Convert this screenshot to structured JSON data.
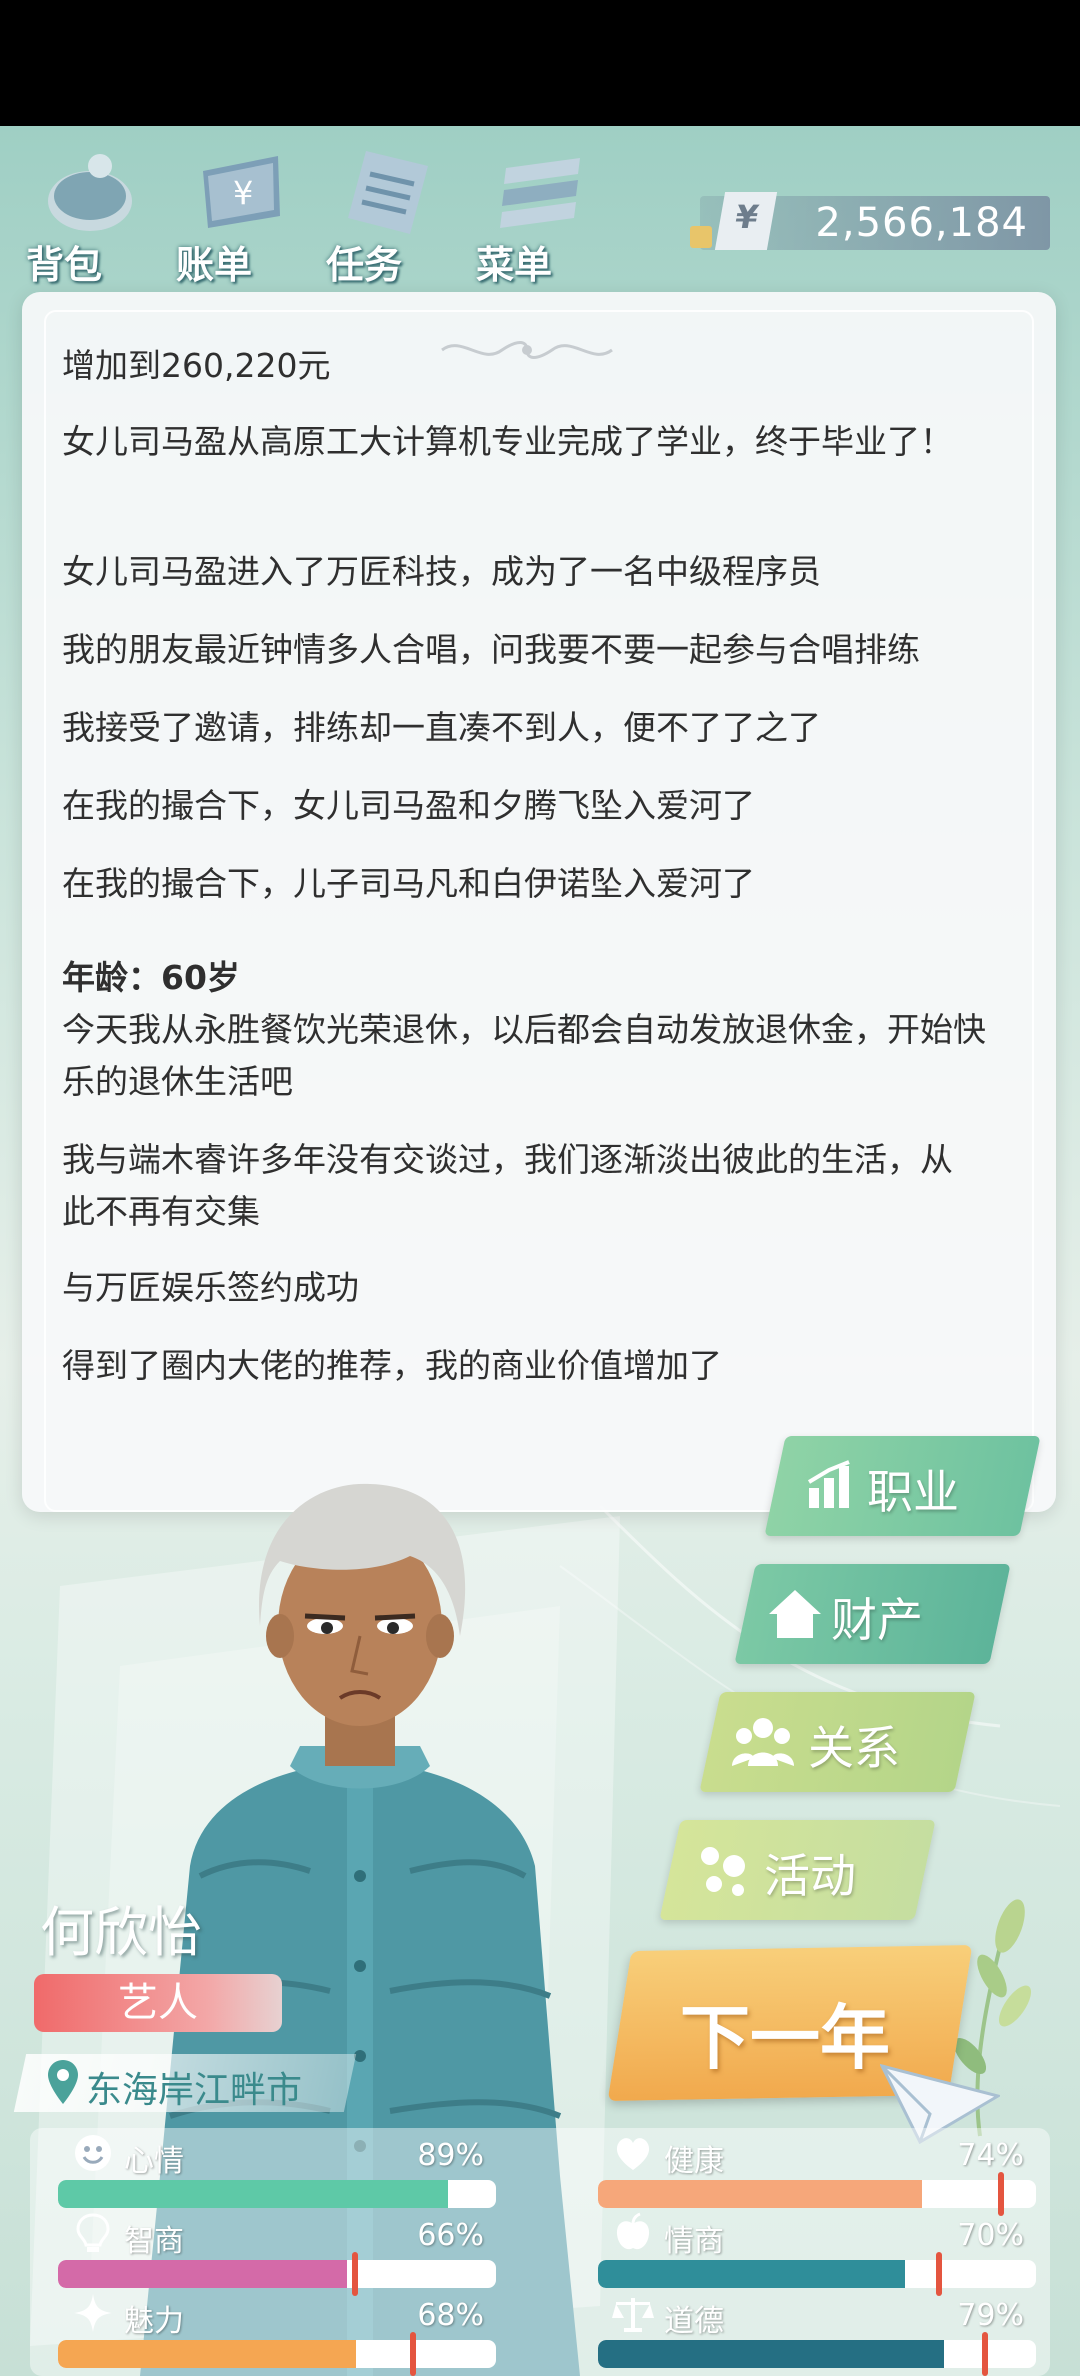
{
  "top_menu": [
    {
      "label": "背包",
      "icon": "backpack-icon"
    },
    {
      "label": "账单",
      "icon": "bill-icon"
    },
    {
      "label": "任务",
      "icon": "task-icon"
    },
    {
      "label": "菜单",
      "icon": "menu-icon"
    }
  ],
  "money": {
    "symbol": "¥",
    "amount": "2,566,184"
  },
  "log": [
    {
      "text": "增加到260,220元",
      "bold": false
    },
    {
      "text": "女儿司马盈从高原工大计算机专业完成了学业，终于毕业了！",
      "bold": false
    },
    {
      "text": "女儿司马盈进入了万匠科技，成为了一名中级程序员",
      "bold": false
    },
    {
      "text": "我的朋友最近钟情多人合唱，问我要不要一起参与合唱排练",
      "bold": false
    },
    {
      "text": "我接受了邀请，排练却一直凑不到人，便不了了之了",
      "bold": false
    },
    {
      "text": "在我的撮合下，女儿司马盈和夕腾飞坠入爱河了",
      "bold": false
    },
    {
      "text": "在我的撮合下，儿子司马凡和白伊诺坠入爱河了",
      "bold": false
    },
    {
      "text": "年龄：60岁",
      "bold": true
    },
    {
      "text": "今天我从永胜餐饮光荣退休，以后都会自动发放退休金，开始快乐的退休生活吧",
      "bold": false
    },
    {
      "text": "我与端木睿许多年没有交谈过，我们逐渐淡出彼此的生活，从此不再有交集",
      "bold": false
    },
    {
      "text": "与万匠娱乐签约成功",
      "bold": false
    },
    {
      "text": "得到了圈内大佬的推荐，我的商业价值增加了",
      "bold": false
    }
  ],
  "right_menu": [
    {
      "label": "职业",
      "icon": "chart-icon"
    },
    {
      "label": "财产",
      "icon": "house-icon"
    },
    {
      "label": "关系",
      "icon": "people-icon"
    },
    {
      "label": "活动",
      "icon": "dots-icon"
    }
  ],
  "next_year": "下一年",
  "character": {
    "name": "何欣怡",
    "job": "艺人",
    "location": "东海岸江畔市"
  },
  "stats": [
    {
      "name": "心情",
      "pct": "89%",
      "value": 0.89,
      "icon": "smile-icon",
      "color": "#5ec9a7"
    },
    {
      "name": "健康",
      "pct": "74%",
      "value": 0.74,
      "icon": "heart-icon",
      "color": "#f6a77a"
    },
    {
      "name": "智商",
      "pct": "66%",
      "value": 0.66,
      "icon": "bulb-icon",
      "color": "#d46aa8"
    },
    {
      "name": "情商",
      "pct": "70%",
      "value": 0.7,
      "icon": "apple-icon",
      "color": "#2f8e9a"
    },
    {
      "name": "魅力",
      "pct": "68%",
      "value": 0.68,
      "icon": "sparkle-icon",
      "color": "#f5a652"
    },
    {
      "name": "道德",
      "pct": "79%",
      "value": 0.79,
      "icon": "scale-icon",
      "color": "#256f83"
    }
  ]
}
